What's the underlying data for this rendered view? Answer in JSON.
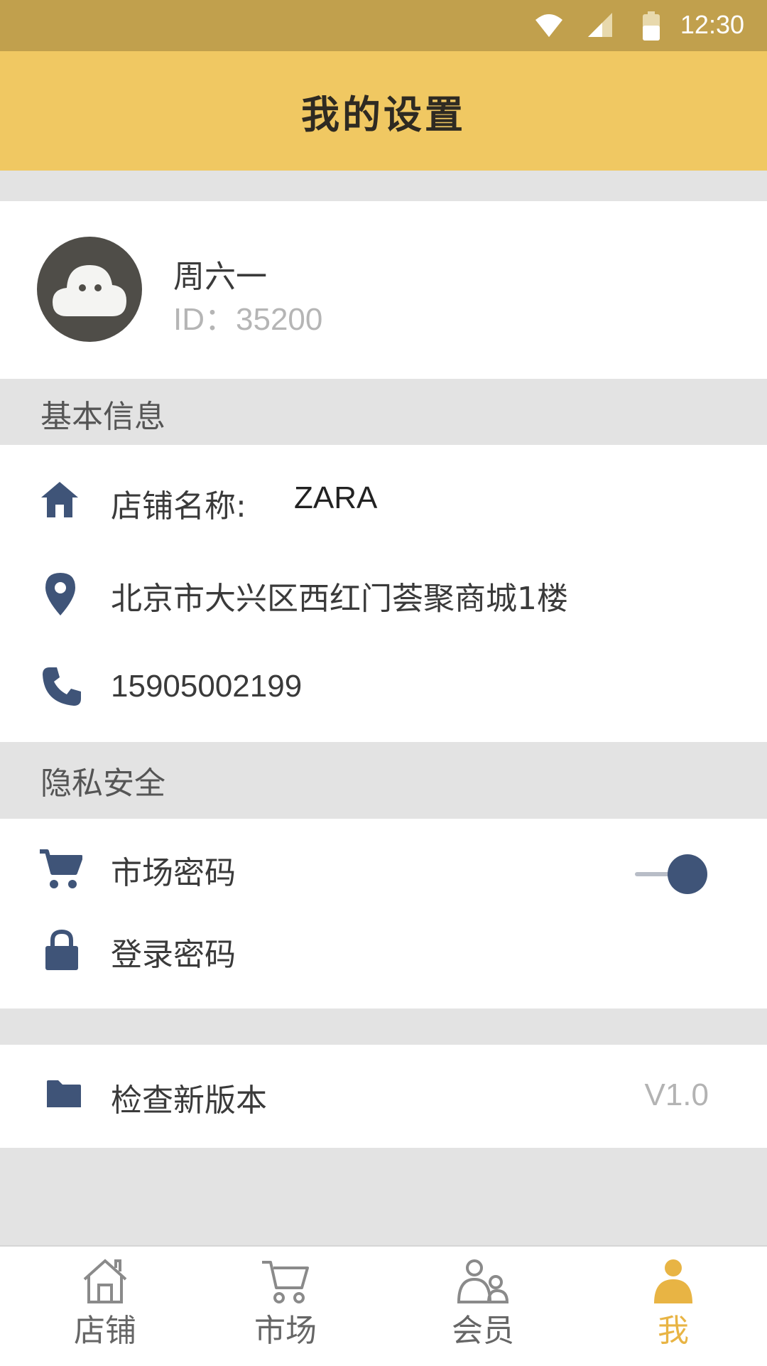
{
  "status_bar": {
    "time": "12:30",
    "icons": [
      "wifi-icon",
      "signal-icon",
      "battery-icon"
    ]
  },
  "header": {
    "title": "我的设置"
  },
  "profile": {
    "name": "周六一",
    "user_id": "ID：35200",
    "avatar_icon": "cloud-face-icon"
  },
  "basic_info": {
    "label": "基本信息",
    "store_name_label": "店铺名称:",
    "store_name_value": "ZARA",
    "address": "北京市大兴区西红门荟聚商城1楼",
    "phone": "15905002199"
  },
  "privacy": {
    "label": "隐私安全",
    "market_password": "市场密码",
    "market_password_enabled": true,
    "login_password": "登录密码"
  },
  "version": {
    "label": "检查新版本",
    "value": "V1.0"
  },
  "tabbar": {
    "items": [
      {
        "label": "店铺",
        "icon": "store-icon"
      },
      {
        "label": "市场",
        "icon": "cart-icon"
      },
      {
        "label": "会员",
        "icon": "members-icon"
      },
      {
        "label": "我",
        "icon": "person-icon",
        "active": true
      }
    ]
  },
  "colors": {
    "status_bar": "#c1a04d",
    "header": "#f0c862",
    "icon_blue": "#3f5478",
    "active_tab": "#e8b444"
  }
}
